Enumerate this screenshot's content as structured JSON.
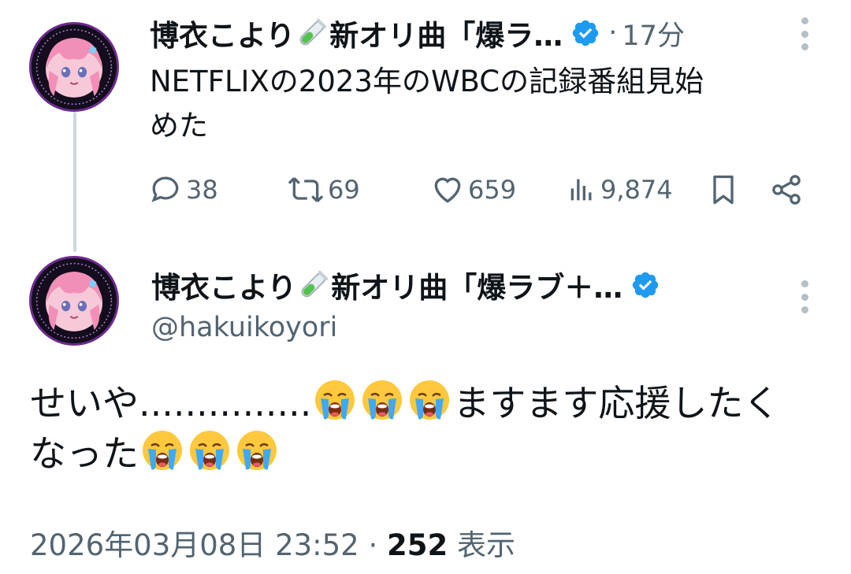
{
  "tweet1": {
    "display_name": "博衣こより",
    "name_suffix": "新オリ曲「爆ラ…",
    "separator": "·",
    "time": "17分",
    "text_line1": "NETFLIXの2023年のWBCの記録番組見始",
    "text_line2": "めた",
    "actions": {
      "replies": "38",
      "reposts": "69",
      "likes": "659",
      "views": "9,874"
    }
  },
  "tweet2": {
    "display_name": "博衣こより",
    "name_suffix": "新オリ曲「爆ラブ＋…",
    "handle": "@hakuikoyori",
    "text_part1": "せいや...............",
    "text_part2": "ますます応援したく",
    "text_part3": "なった",
    "date": "2026年03月08日 23:52",
    "separator": "·",
    "views_count": "252",
    "views_label": "表示"
  },
  "icons": {
    "avatar": "avatar-image",
    "verified": "verified-badge-icon",
    "test_tube": "test-tube-emoji",
    "crying": "loudly-crying-face-emoji",
    "more": "more-vertical-icon",
    "reply": "reply-icon",
    "repost": "repost-icon",
    "like": "heart-icon",
    "views": "analytics-icon",
    "bookmark": "bookmark-icon",
    "share": "share-icon"
  },
  "colors": {
    "text_primary": "#0f1419",
    "text_secondary": "#536471",
    "verified": "#1d9bf0",
    "thread_line": "#cfd9de",
    "avatar_ring": "#6d2b8f"
  }
}
